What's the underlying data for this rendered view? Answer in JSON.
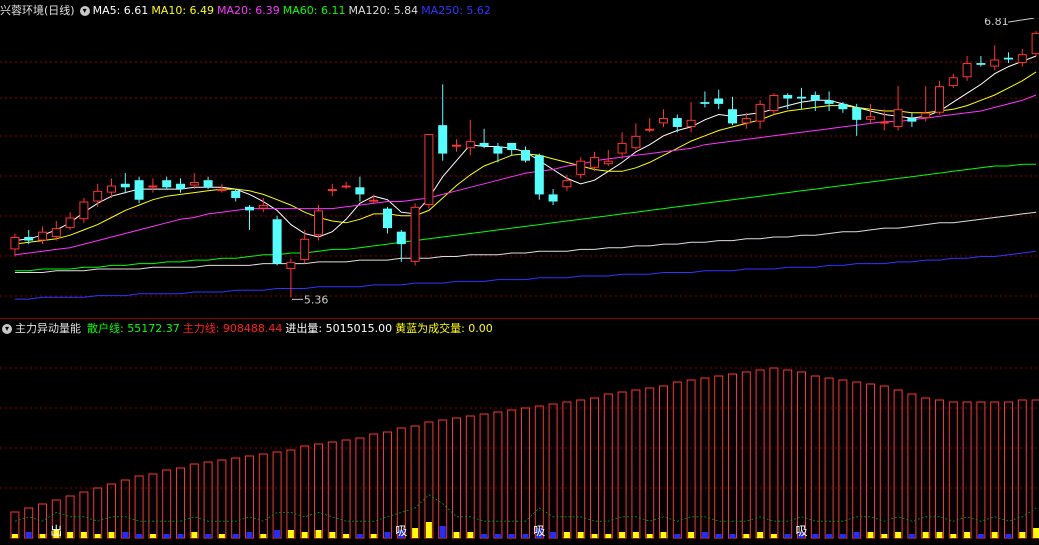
{
  "stock": {
    "name": "兴蓉环境",
    "period": "(日线)"
  },
  "ma_legend": [
    {
      "label": "MA5:",
      "value": "6.61",
      "color": "#ffffff"
    },
    {
      "label": "MA10:",
      "value": "6.49",
      "color": "#ffff00"
    },
    {
      "label": "MA20:",
      "value": "6.39",
      "color": "#ff33ff"
    },
    {
      "label": "MA60:",
      "value": "6.11",
      "color": "#00ff00"
    },
    {
      "label": "MA120:",
      "value": "5.84",
      "color": "#dddddd"
    },
    {
      "label": "MA250:",
      "value": "5.62",
      "color": "#3333ff"
    }
  ],
  "indicator": {
    "name": "主力异动量能",
    "items": [
      {
        "label": "散户线:",
        "value": "55172.37",
        "color": "#00ff00"
      },
      {
        "label": "主力线:",
        "value": "908488.44",
        "color": "#ff2020"
      },
      {
        "label": "进出量:",
        "value": "5015015.00",
        "color": "#ffffff"
      },
      {
        "label": "黄蓝为成交量:",
        "value": "0.00",
        "color": "#ffff00"
      }
    ],
    "markers": [
      {
        "text": "出",
        "index": 3
      },
      {
        "text": "吸",
        "index": 28
      },
      {
        "text": "吸",
        "index": 38
      },
      {
        "text": "吸",
        "index": 57
      }
    ]
  },
  "price_annotations": {
    "high": "6.81",
    "low": "5.36"
  },
  "colors": {
    "up": "#ff3232",
    "down": "#54ffff",
    "grid": "#8b0000",
    "volume_up": "#ffff00",
    "volume_down": "#1f2fff"
  },
  "chart_data": {
    "type": "candlestick",
    "price_range": [
      5.3,
      6.9
    ],
    "candles": [
      [
        5.63,
        5.7,
        5.59,
        5.72
      ],
      [
        5.7,
        5.68,
        5.66,
        5.74
      ],
      [
        5.68,
        5.73,
        5.66,
        5.76
      ],
      [
        5.7,
        5.75,
        5.68,
        5.79
      ],
      [
        5.75,
        5.81,
        5.74,
        5.84
      ],
      [
        5.8,
        5.9,
        5.78,
        5.92
      ],
      [
        5.9,
        5.96,
        5.87,
        6.0
      ],
      [
        5.95,
        5.99,
        5.92,
        6.03
      ],
      [
        6.0,
        5.98,
        5.95,
        6.06
      ],
      [
        6.02,
        5.91,
        5.89,
        6.04
      ],
      [
        5.98,
        5.99,
        5.95,
        6.03
      ],
      [
        6.02,
        5.98,
        5.97,
        6.04
      ],
      [
        6.0,
        5.97,
        5.95,
        6.03
      ],
      [
        5.99,
        6.01,
        5.97,
        6.06
      ],
      [
        6.02,
        5.98,
        5.97,
        6.04
      ],
      [
        5.97,
        5.97,
        5.95,
        6.0
      ],
      [
        5.96,
        5.92,
        5.9,
        5.97
      ],
      [
        5.87,
        5.85,
        5.74,
        5.88
      ],
      [
        5.86,
        5.88,
        5.84,
        5.92
      ],
      [
        5.8,
        5.55,
        5.54,
        5.82
      ],
      [
        5.52,
        5.56,
        5.36,
        5.58
      ],
      [
        5.57,
        5.69,
        5.55,
        5.74
      ],
      [
        5.71,
        5.85,
        5.68,
        5.88
      ],
      [
        5.96,
        5.97,
        5.93,
        6.0
      ],
      [
        5.99,
        5.99,
        5.97,
        6.01
      ],
      [
        5.98,
        5.94,
        5.9,
        6.04
      ],
      [
        5.9,
        5.91,
        5.89,
        5.94
      ],
      [
        5.86,
        5.75,
        5.72,
        5.87
      ],
      [
        5.73,
        5.66,
        5.56,
        5.74
      ],
      [
        5.56,
        5.87,
        5.54,
        5.89
      ],
      [
        5.88,
        6.28,
        5.86,
        6.28
      ],
      [
        6.33,
        6.17,
        6.13,
        6.56
      ],
      [
        6.21,
        6.22,
        6.18,
        6.25
      ],
      [
        6.2,
        6.24,
        6.16,
        6.36
      ],
      [
        6.23,
        6.21,
        6.2,
        6.31
      ],
      [
        6.21,
        6.17,
        6.12,
        6.23
      ],
      [
        6.23,
        6.19,
        6.16,
        6.23
      ],
      [
        6.19,
        6.13,
        6.12,
        6.21
      ],
      [
        6.16,
        5.94,
        5.91,
        6.17
      ],
      [
        5.94,
        5.9,
        5.88,
        5.97
      ],
      [
        5.98,
        6.02,
        5.96,
        6.05
      ],
      [
        6.05,
        6.13,
        6.03,
        6.15
      ],
      [
        6.09,
        6.15,
        6.07,
        6.18
      ],
      [
        6.11,
        6.13,
        6.1,
        6.19
      ],
      [
        6.17,
        6.23,
        6.14,
        6.29
      ],
      [
        6.2,
        6.27,
        6.19,
        6.34
      ],
      [
        6.31,
        6.31,
        6.29,
        6.37
      ],
      [
        6.34,
        6.37,
        6.32,
        6.42
      ],
      [
        6.37,
        6.32,
        6.29,
        6.39
      ],
      [
        6.32,
        6.36,
        6.29,
        6.46
      ],
      [
        6.46,
        6.45,
        6.43,
        6.52
      ],
      [
        6.48,
        6.45,
        6.42,
        6.53
      ],
      [
        6.42,
        6.34,
        6.33,
        6.49
      ],
      [
        6.34,
        6.37,
        6.31,
        6.4
      ],
      [
        6.35,
        6.45,
        6.31,
        6.47
      ],
      [
        6.41,
        6.5,
        6.39,
        6.51
      ],
      [
        6.5,
        6.48,
        6.42,
        6.51
      ],
      [
        6.49,
        6.48,
        6.42,
        6.54
      ],
      [
        6.5,
        6.47,
        6.41,
        6.52
      ],
      [
        6.47,
        6.45,
        6.41,
        6.52
      ],
      [
        6.45,
        6.42,
        6.4,
        6.46
      ],
      [
        6.43,
        6.36,
        6.27,
        6.45
      ],
      [
        6.36,
        6.38,
        6.34,
        6.45
      ],
      [
        6.35,
        6.35,
        6.3,
        6.42
      ],
      [
        6.32,
        6.42,
        6.3,
        6.55
      ],
      [
        6.37,
        6.35,
        6.32,
        6.4
      ],
      [
        6.37,
        6.4,
        6.35,
        6.55
      ],
      [
        6.4,
        6.55,
        6.39,
        6.58
      ],
      [
        6.55,
        6.6,
        6.54,
        6.62
      ],
      [
        6.6,
        6.68,
        6.58,
        6.72
      ],
      [
        6.68,
        6.67,
        6.66,
        6.72
      ],
      [
        6.66,
        6.7,
        6.64,
        6.78
      ],
      [
        6.71,
        6.7,
        6.68,
        6.74
      ],
      [
        6.68,
        6.73,
        6.66,
        6.76
      ],
      [
        6.73,
        6.85,
        6.72,
        6.86
      ]
    ],
    "ma": {
      "MA5": [
        5.68,
        5.69,
        5.71,
        5.74,
        5.78,
        5.84,
        5.89,
        5.93,
        5.95,
        5.97,
        5.97,
        5.97,
        5.97,
        5.98,
        5.98,
        5.98,
        5.97,
        5.94,
        5.9,
        5.85,
        5.77,
        5.72,
        5.7,
        5.73,
        5.8,
        5.89,
        5.93,
        5.91,
        5.84,
        5.83,
        5.92,
        6.04,
        6.13,
        6.22,
        6.21,
        6.21,
        6.2,
        6.18,
        6.13,
        6.08,
        6.03,
        6.0,
        6.02,
        6.07,
        6.12,
        6.18,
        6.22,
        6.27,
        6.3,
        6.32,
        6.36,
        6.39,
        6.38,
        6.39,
        6.4,
        6.42,
        6.44,
        6.46,
        6.47,
        6.47,
        6.45,
        6.43,
        6.41,
        6.39,
        6.38,
        6.37,
        6.38,
        6.41,
        6.46,
        6.51,
        6.56,
        6.62,
        6.66,
        6.69,
        6.72
      ],
      "MA10": [
        5.66,
        5.67,
        5.68,
        5.69,
        5.71,
        5.74,
        5.77,
        5.81,
        5.85,
        5.88,
        5.91,
        5.93,
        5.94,
        5.95,
        5.96,
        5.97,
        5.97,
        5.96,
        5.94,
        5.91,
        5.88,
        5.84,
        5.81,
        5.79,
        5.78,
        5.8,
        5.83,
        5.83,
        5.82,
        5.82,
        5.85,
        5.92,
        5.99,
        6.05,
        6.1,
        6.13,
        6.16,
        6.17,
        6.16,
        6.14,
        6.12,
        6.1,
        6.08,
        6.07,
        6.07,
        6.09,
        6.12,
        6.16,
        6.2,
        6.24,
        6.27,
        6.3,
        6.32,
        6.34,
        6.36,
        6.39,
        6.41,
        6.42,
        6.43,
        6.44,
        6.44,
        6.43,
        6.42,
        6.41,
        6.41,
        6.4,
        6.4,
        6.41,
        6.42,
        6.44,
        6.47,
        6.5,
        6.54,
        6.58,
        6.63
      ],
      "MA20": [
        5.6,
        5.61,
        5.62,
        5.63,
        5.64,
        5.66,
        5.68,
        5.7,
        5.72,
        5.74,
        5.76,
        5.78,
        5.8,
        5.81,
        5.83,
        5.84,
        5.85,
        5.86,
        5.86,
        5.86,
        5.86,
        5.86,
        5.86,
        5.86,
        5.87,
        5.88,
        5.89,
        5.9,
        5.9,
        5.91,
        5.92,
        5.94,
        5.96,
        5.98,
        6.0,
        6.02,
        6.04,
        6.06,
        6.07,
        6.08,
        6.1,
        6.11,
        6.13,
        6.14,
        6.15,
        6.16,
        6.17,
        6.18,
        6.19,
        6.2,
        6.22,
        6.23,
        6.24,
        6.25,
        6.26,
        6.27,
        6.28,
        6.29,
        6.3,
        6.31,
        6.32,
        6.33,
        6.34,
        6.35,
        6.35,
        6.36,
        6.37,
        6.38,
        6.39,
        6.4,
        6.41,
        6.43,
        6.45,
        6.47,
        6.5
      ],
      "MA60": [
        5.51,
        5.51,
        5.52,
        5.52,
        5.52,
        5.53,
        5.53,
        5.54,
        5.54,
        5.55,
        5.55,
        5.56,
        5.56,
        5.57,
        5.57,
        5.58,
        5.58,
        5.59,
        5.6,
        5.6,
        5.61,
        5.61,
        5.62,
        5.63,
        5.63,
        5.64,
        5.65,
        5.66,
        5.67,
        5.68,
        5.69,
        5.7,
        5.71,
        5.72,
        5.73,
        5.74,
        5.75,
        5.76,
        5.77,
        5.78,
        5.79,
        5.8,
        5.81,
        5.82,
        5.83,
        5.84,
        5.85,
        5.86,
        5.87,
        5.88,
        5.89,
        5.9,
        5.91,
        5.92,
        5.93,
        5.94,
        5.95,
        5.96,
        5.97,
        5.98,
        5.99,
        6.0,
        6.01,
        6.02,
        6.03,
        6.04,
        6.05,
        6.06,
        6.07,
        6.08,
        6.09,
        6.1,
        6.1,
        6.11,
        6.11
      ],
      "MA120": [
        5.5,
        5.5,
        5.5,
        5.51,
        5.51,
        5.51,
        5.52,
        5.52,
        5.52,
        5.52,
        5.53,
        5.53,
        5.53,
        5.53,
        5.54,
        5.54,
        5.54,
        5.54,
        5.55,
        5.55,
        5.55,
        5.55,
        5.56,
        5.56,
        5.56,
        5.57,
        5.57,
        5.57,
        5.58,
        5.58,
        5.58,
        5.59,
        5.59,
        5.6,
        5.6,
        5.6,
        5.61,
        5.61,
        5.62,
        5.62,
        5.62,
        5.63,
        5.63,
        5.64,
        5.64,
        5.65,
        5.65,
        5.66,
        5.66,
        5.67,
        5.67,
        5.68,
        5.68,
        5.69,
        5.69,
        5.7,
        5.7,
        5.71,
        5.71,
        5.72,
        5.73,
        5.73,
        5.74,
        5.75,
        5.75,
        5.76,
        5.77,
        5.78,
        5.78,
        5.79,
        5.8,
        5.81,
        5.82,
        5.83,
        5.84
      ],
      "MA250": [
        5.35,
        5.35,
        5.36,
        5.36,
        5.36,
        5.36,
        5.37,
        5.37,
        5.37,
        5.38,
        5.38,
        5.38,
        5.38,
        5.39,
        5.39,
        5.39,
        5.4,
        5.4,
        5.4,
        5.41,
        5.41,
        5.41,
        5.42,
        5.42,
        5.42,
        5.42,
        5.43,
        5.43,
        5.43,
        5.44,
        5.44,
        5.44,
        5.45,
        5.45,
        5.45,
        5.46,
        5.46,
        5.46,
        5.47,
        5.47,
        5.47,
        5.48,
        5.48,
        5.48,
        5.49,
        5.49,
        5.49,
        5.5,
        5.5,
        5.5,
        5.51,
        5.51,
        5.51,
        5.52,
        5.52,
        5.52,
        5.53,
        5.53,
        5.53,
        5.54,
        5.54,
        5.55,
        5.55,
        5.55,
        5.56,
        5.56,
        5.57,
        5.57,
        5.58,
        5.58,
        5.59,
        5.59,
        5.6,
        5.61,
        5.62
      ]
    },
    "main_line": [
      0.13,
      0.15,
      0.17,
      0.19,
      0.21,
      0.23,
      0.25,
      0.27,
      0.29,
      0.31,
      0.32,
      0.34,
      0.35,
      0.37,
      0.38,
      0.39,
      0.4,
      0.41,
      0.42,
      0.43,
      0.44,
      0.46,
      0.47,
      0.48,
      0.49,
      0.5,
      0.52,
      0.53,
      0.55,
      0.56,
      0.58,
      0.59,
      0.6,
      0.61,
      0.62,
      0.63,
      0.64,
      0.65,
      0.66,
      0.67,
      0.68,
      0.69,
      0.7,
      0.72,
      0.73,
      0.74,
      0.75,
      0.76,
      0.78,
      0.79,
      0.8,
      0.81,
      0.82,
      0.83,
      0.84,
      0.85,
      0.84,
      0.83,
      0.81,
      0.8,
      0.79,
      0.78,
      0.77,
      0.76,
      0.74,
      0.72,
      0.7,
      0.69,
      0.68,
      0.68,
      0.68,
      0.68,
      0.68,
      0.69,
      0.69
    ],
    "volume": [
      0.02,
      0.03,
      0.02,
      0.04,
      0.03,
      0.03,
      0.02,
      0.03,
      0.03,
      0.02,
      0.02,
      0.02,
      0.02,
      0.03,
      0.02,
      0.02,
      0.02,
      0.03,
      0.02,
      0.04,
      0.04,
      0.03,
      0.04,
      0.03,
      0.02,
      0.02,
      0.02,
      0.03,
      0.04,
      0.05,
      0.08,
      0.06,
      0.03,
      0.03,
      0.02,
      0.02,
      0.02,
      0.02,
      0.05,
      0.03,
      0.03,
      0.03,
      0.02,
      0.02,
      0.03,
      0.03,
      0.02,
      0.03,
      0.02,
      0.03,
      0.03,
      0.02,
      0.02,
      0.02,
      0.03,
      0.02,
      0.02,
      0.03,
      0.02,
      0.02,
      0.02,
      0.03,
      0.03,
      0.02,
      0.03,
      0.02,
      0.03,
      0.03,
      0.02,
      0.03,
      0.02,
      0.03,
      0.02,
      0.03,
      0.05
    ]
  }
}
